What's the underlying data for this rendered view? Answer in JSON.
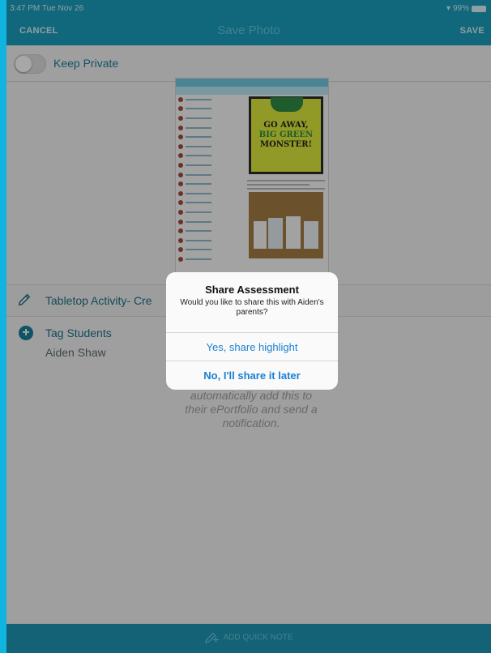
{
  "status": {
    "time_date": "3:47 PM  Tue Nov 26",
    "battery": "99%"
  },
  "nav": {
    "cancel": "CANCEL",
    "title": "Save Photo",
    "save": "SAVE"
  },
  "privacy": {
    "label": "Keep Private",
    "enabled": false
  },
  "photo_preview": {
    "book_title_lines": [
      "GO AWAY,",
      "BIG GREEN",
      "MONSTER!"
    ]
  },
  "activity": {
    "label": "Tabletop Activity- Cre"
  },
  "tag": {
    "label": "Tag Students",
    "student": "Aiden Shaw"
  },
  "hint": {
    "text": "automatically add this to their ePortfolio and send a notification."
  },
  "bottom": {
    "quick_note": "ADD QUICK NOTE"
  },
  "dialog": {
    "title": "Share Assessment",
    "message": "Would you like to share this with Aiden's parents?",
    "yes": "Yes, share highlight",
    "no": "No, I'll share it later"
  },
  "colors": {
    "accent": "#1a9ab8",
    "link": "#1b7fd1",
    "background": "#ededee"
  }
}
